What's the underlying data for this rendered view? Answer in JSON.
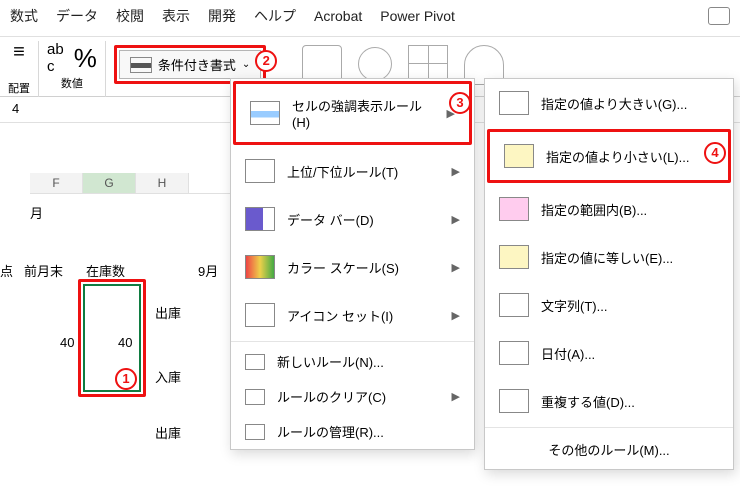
{
  "menu": {
    "items": [
      "数式",
      "データ",
      "校閲",
      "表示",
      "開発",
      "ヘルプ",
      "Acrobat",
      "Power Pivot"
    ]
  },
  "ribbon": {
    "layout_group": "配置",
    "number_group": "数値",
    "conditional_formatting_label": "条件付き書式"
  },
  "formula_bar": {
    "value": "4"
  },
  "columns": [
    "F",
    "G",
    "H"
  ],
  "cells": {
    "month": "月",
    "label_k": "点",
    "label_prev": "前月末",
    "label_stock": "在庫数",
    "label_sept": "9月",
    "label_out1": "出庫",
    "label_in": "入庫",
    "label_out2": "出庫",
    "val_f": "40",
    "val_g": "40"
  },
  "cf_menu": {
    "highlight_rules": "セルの強調表示ルール(H)",
    "top_bottom": "上位/下位ルール(T)",
    "data_bars": "データ バー(D)",
    "color_scales": "カラー スケール(S)",
    "icon_sets": "アイコン セット(I)",
    "new_rule": "新しいルール(N)...",
    "clear_rules": "ルールのクリア(C)",
    "manage_rules": "ルールの管理(R)..."
  },
  "hl_submenu": {
    "greater": "指定の値より大きい(G)...",
    "less": "指定の値より小さい(L)...",
    "between": "指定の範囲内(B)...",
    "equal": "指定の値に等しい(E)...",
    "text": "文字列(T)...",
    "date": "日付(A)...",
    "dup": "重複する値(D)...",
    "other": "その他のルール(M)..."
  },
  "annotations": {
    "a1": "1",
    "a2": "2",
    "a3": "3",
    "a4": "4"
  }
}
